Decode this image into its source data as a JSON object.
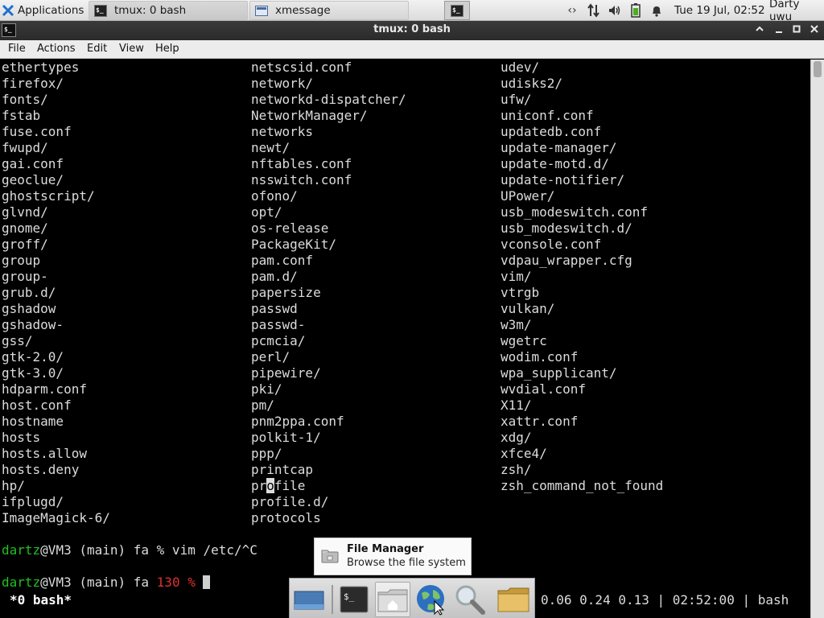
{
  "top_panel": {
    "apps_label": "Applications",
    "tasks": [
      {
        "label": "tmux: 0 bash"
      },
      {
        "label": "xmessage"
      }
    ],
    "clock": "Tue 19 Jul, 02:52",
    "user": "Darty uwu",
    "tray_icons": [
      "network-transfer-icon",
      "updown-arrows-icon",
      "volume-icon",
      "battery-icon",
      "notification-bell-icon"
    ]
  },
  "window": {
    "title": "tmux: 0 bash",
    "controls": [
      "minimize",
      "maximize",
      "restore",
      "close"
    ]
  },
  "menubar": {
    "items": [
      "File",
      "Actions",
      "Edit",
      "View",
      "Help"
    ]
  },
  "terminal": {
    "rows": [
      [
        "ethertypes",
        "netscsid.conf",
        "udev/"
      ],
      [
        "firefox/",
        "network/",
        "udisks2/"
      ],
      [
        "fonts/",
        "networkd-dispatcher/",
        "ufw/"
      ],
      [
        "fstab",
        "NetworkManager/",
        "uniconf.conf"
      ],
      [
        "fuse.conf",
        "networks",
        "updatedb.conf"
      ],
      [
        "fwupd/",
        "newt/",
        "update-manager/"
      ],
      [
        "gai.conf",
        "nftables.conf",
        "update-motd.d/"
      ],
      [
        "geoclue/",
        "nsswitch.conf",
        "update-notifier/"
      ],
      [
        "ghostscript/",
        "ofono/",
        "UPower/"
      ],
      [
        "glvnd/",
        "opt/",
        "usb_modeswitch.conf"
      ],
      [
        "gnome/",
        "os-release",
        "usb_modeswitch.d/"
      ],
      [
        "groff/",
        "PackageKit/",
        "vconsole.conf"
      ],
      [
        "group",
        "pam.conf",
        "vdpau_wrapper.cfg"
      ],
      [
        "group-",
        "pam.d/",
        "vim/"
      ],
      [
        "grub.d/",
        "papersize",
        "vtrgb"
      ],
      [
        "gshadow",
        "passwd",
        "vulkan/"
      ],
      [
        "gshadow-",
        "passwd-",
        "w3m/"
      ],
      [
        "gss/",
        "pcmcia/",
        "wgetrc"
      ],
      [
        "gtk-2.0/",
        "perl/",
        "wodim.conf"
      ],
      [
        "gtk-3.0/",
        "pipewire/",
        "wpa_supplicant/"
      ],
      [
        "hdparm.conf",
        "pki/",
        "wvdial.conf"
      ],
      [
        "host.conf",
        "pm/",
        "X11/"
      ],
      [
        "hostname",
        "pnm2ppa.conf",
        "xattr.conf"
      ],
      [
        "hosts",
        "polkit-1/",
        "xdg/"
      ],
      [
        "hosts.allow",
        "ppp/",
        "xfce4/"
      ],
      [
        "hosts.deny",
        "printcap",
        "zsh/"
      ],
      [
        "hp/",
        "",
        "zsh_command_not_found"
      ],
      [
        "ifplugd/",
        "profile.d/",
        ""
      ],
      [
        "ImageMagick-6/",
        "protocols",
        ""
      ]
    ],
    "profile_row": {
      "before": "pr",
      "cursor": "o",
      "after": "file"
    },
    "prompt1": {
      "user": "dartz",
      "rest": "@VM3 (main) fa % vim /etc/^C"
    },
    "prompt2": {
      "user": "dartz",
      "rest": "@VM3 (main) fa ",
      "code": "130 %"
    },
    "tmux_window": "*0 bash*",
    "tmux_right": "0.06 0.24 0.13 | 02:52:00 | bash"
  },
  "tooltip": {
    "title": "File Manager",
    "description": "Browse the file system"
  },
  "dock": {
    "items": [
      "show-desktop",
      "terminal",
      "home-folder",
      "web-browser",
      "search",
      "files-folder"
    ]
  },
  "colors": {
    "prompt_user": "#1fc11f",
    "exit_code": "#e03030"
  }
}
